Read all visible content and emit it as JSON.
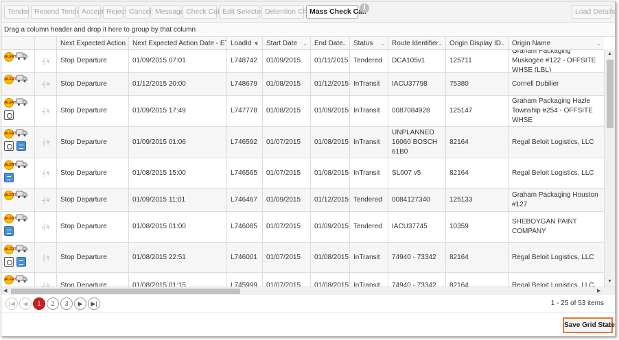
{
  "toolbar": {
    "buttons": [
      {
        "label": "Tender",
        "enabled": false
      },
      {
        "label": "Resend Tender",
        "enabled": false
      },
      {
        "label": "Accept",
        "enabled": false
      },
      {
        "label": "Reject",
        "enabled": false
      },
      {
        "label": "Cancel",
        "enabled": false
      },
      {
        "label": "Message",
        "enabled": false
      },
      {
        "label": "Check Call",
        "enabled": false
      },
      {
        "label": "Edit Selected",
        "enabled": false
      },
      {
        "label": "Detention Chg",
        "enabled": false
      },
      {
        "label": "Mass Check Call",
        "enabled": true
      }
    ],
    "info_icon": "i",
    "load_details_label": "Load Details"
  },
  "group_bar_text": "Drag a column header and drop it here to group by that column",
  "columns": [
    {
      "label": "",
      "filter": false
    },
    {
      "label": "",
      "filter": false
    },
    {
      "label": "Next Expected Action",
      "filter": true
    },
    {
      "label": "Next Expected Action Date - ET",
      "filter": true
    },
    {
      "label": "LoadId",
      "filter": true,
      "sorted": true
    },
    {
      "label": "Start Date",
      "filter": true
    },
    {
      "label": "End Date",
      "filter": true
    },
    {
      "label": "Status",
      "filter": true
    },
    {
      "label": "Route Identifier",
      "filter": true
    },
    {
      "label": "Origin Display ID",
      "filter": true
    },
    {
      "label": "Origin Name",
      "filter": true
    }
  ],
  "rows": [
    {
      "icons": [
        "alert-icon",
        "truck-icon"
      ],
      "action": "Stop Departure",
      "action_date": "01/09/2015 07:01",
      "load_id": "L748742",
      "start": "01/09/2015",
      "end": "01/11/2015",
      "status": "Tendered",
      "route": "DCA105v1",
      "origin_id": "125711",
      "origin_name": "Graham Packaging Muskogee #122 - OFFSITE WHSE (LBL)"
    },
    {
      "icons": [
        "alert-icon",
        "truck-icon"
      ],
      "action": "Stop Departure",
      "action_date": "01/12/2015 20:00",
      "load_id": "L748679",
      "start": "01/08/2015",
      "end": "01/12/2015",
      "status": "InTransit",
      "route": "IACU37798",
      "origin_id": "75380",
      "origin_name": "Cornell Dubilier"
    },
    {
      "icons": [
        "alert-icon",
        "truck-icon",
        "clock-icon"
      ],
      "action": "Stop Departure",
      "action_date": "01/09/2015 17:49",
      "load_id": "L747778",
      "start": "01/08/2015",
      "end": "01/09/2015",
      "status": "InTransit",
      "route": "0087084928",
      "origin_id": "125147",
      "origin_name": "Graham Packaging Hazle Township #254 - OFFSITE WHSE"
    },
    {
      "icons": [
        "alert-icon",
        "truck-icon",
        "clock-icon",
        "document-icon"
      ],
      "action": "Stop Departure",
      "action_date": "01/09/2015 01:06",
      "load_id": "L746592",
      "start": "01/07/2015",
      "end": "01/08/2015",
      "status": "InTransit",
      "route": "UNPLANNED 16060 BOSCH 61B0",
      "origin_id": "82164",
      "origin_name": "Regal Beloit Logistics, LLC"
    },
    {
      "icons": [
        "alert-icon",
        "truck-icon",
        "document-icon"
      ],
      "action": "Stop Departure",
      "action_date": "01/08/2015 15:00",
      "load_id": "L746565",
      "start": "01/07/2015",
      "end": "01/08/2015",
      "status": "InTransit",
      "route": "SL007 v5",
      "origin_id": "82164",
      "origin_name": "Regal Beloit Logistics, LLC"
    },
    {
      "icons": [
        "alert-icon",
        "truck-icon"
      ],
      "action": "Stop Departure",
      "action_date": "01/09/2015 11:01",
      "load_id": "L746467",
      "start": "01/09/2015",
      "end": "01/12/2015",
      "status": "Tendered",
      "route": "0084127340",
      "origin_id": "125133",
      "origin_name": "Graham Packaging Houston #127"
    },
    {
      "icons": [
        "alert-icon",
        "truck-icon",
        "document-icon"
      ],
      "action": "Stop Departure",
      "action_date": "01/08/2015 01:00",
      "load_id": "L746085",
      "start": "01/07/2015",
      "end": "01/09/2015",
      "status": "Tendered",
      "route": "IACU37745",
      "origin_id": "10359",
      "origin_name": "SHEBOYGAN PAINT COMPANY"
    },
    {
      "icons": [
        "alert-icon",
        "truck-icon",
        "clock-icon",
        "document-icon"
      ],
      "action": "Stop Departure",
      "action_date": "01/08/2015 22:51",
      "load_id": "L746001",
      "start": "01/07/2015",
      "end": "01/08/2015",
      "status": "InTransit",
      "route": "74940 - 73342",
      "origin_id": "82164",
      "origin_name": "Regal Beloit Logistics, LLC"
    },
    {
      "icons": [
        "alert-icon",
        "truck-icon"
      ],
      "action": "Stop Departure",
      "action_date": "01/08/2015 01:15",
      "load_id": "L745999",
      "start": "01/07/2015",
      "end": "01/08/2015",
      "status": "InTransit",
      "route": "74940 - 73342",
      "origin_id": "82164",
      "origin_name": "Regal Beloit Logistics, LLC"
    }
  ],
  "pager": {
    "first_icon": "first-page-icon",
    "prev_icon": "prev-page-icon",
    "pages": [
      "1",
      "2",
      "3"
    ],
    "current_page": "1",
    "next_icon": "next-page-icon",
    "last_icon": "last-page-icon",
    "info": "1 - 25 of 53 items"
  },
  "save_grid_label": "Save Grid State",
  "colors": {
    "accent_page": "#cc1f1f",
    "highlight_border": "#e8792f"
  }
}
